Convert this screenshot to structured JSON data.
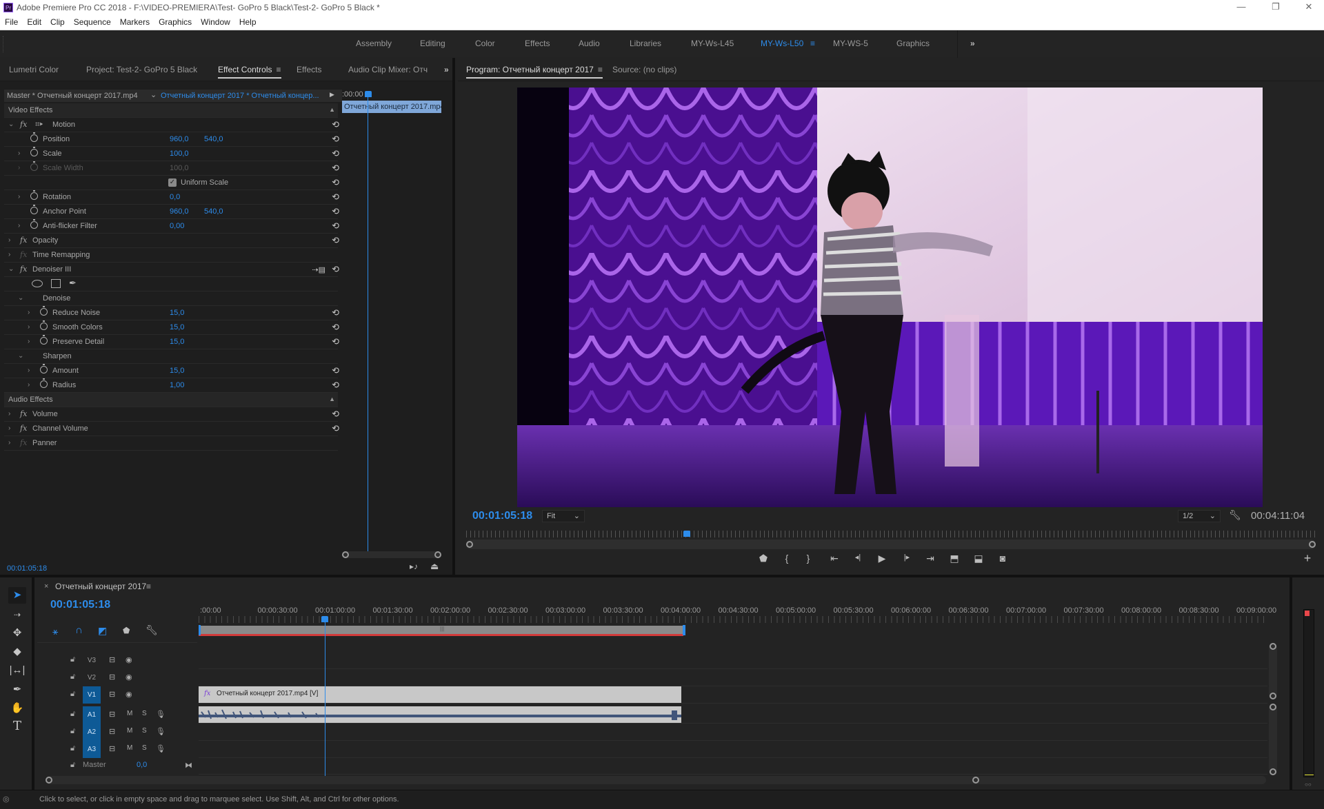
{
  "window": {
    "title": "Adobe Premiere Pro CC 2018 - F:\\VIDEO-PREMIERA\\Test- GoPro 5 Black\\Test-2- GoPro 5 Black *",
    "app_icon": "Pr",
    "controls": {
      "minimize": "—",
      "maximize": "❐",
      "close": "✕"
    }
  },
  "menu": [
    "File",
    "Edit",
    "Clip",
    "Sequence",
    "Markers",
    "Graphics",
    "Window",
    "Help"
  ],
  "workspaces": {
    "items": [
      "Assembly",
      "Editing",
      "Color",
      "Effects",
      "Audio",
      "Libraries",
      "MY-Ws-L45",
      "MY-Ws-L50",
      "MY-WS-5",
      "Graphics"
    ],
    "active": "MY-Ws-L50",
    "overflow": "»",
    "menu_icon": "≡"
  },
  "left_panel": {
    "tabs": [
      "Lumetri Color",
      "Project: Test-2- GoPro 5 Black",
      "Effect Controls",
      "Effects",
      "Audio Clip Mixer: Отчет"
    ],
    "active_tab": "Effect Controls",
    "overflow": "»",
    "header": {
      "master": "Master * Отчетный концерт 2017.mp4",
      "clip": "Отчетный концерт 2017 * Отчетный концер...",
      "timecode": ":00:00"
    },
    "mini_clip": "Отчетный концерт 2017.mp4",
    "sections": {
      "video": "Video Effects",
      "audio": "Audio Effects"
    },
    "rows": [
      {
        "label": "Motion",
        "type": "fx"
      },
      {
        "label": "Position",
        "v1": "960,0",
        "v2": "540,0"
      },
      {
        "label": "Scale",
        "v1": "100,0"
      },
      {
        "label": "Scale Width",
        "v1": "100,0"
      },
      {
        "label": "Uniform Scale",
        "checked": true
      },
      {
        "label": "Rotation",
        "v1": "0,0"
      },
      {
        "label": "Anchor Point",
        "v1": "960,0",
        "v2": "540,0"
      },
      {
        "label": "Anti-flicker Filter",
        "v1": "0,00"
      },
      {
        "label": "Opacity",
        "type": "fx"
      },
      {
        "label": "Time Remapping",
        "type": "fx"
      },
      {
        "label": "Denoiser III",
        "type": "fx"
      },
      {
        "label": "Denoise"
      },
      {
        "label": "Reduce Noise",
        "v1": "15,0"
      },
      {
        "label": "Smooth Colors",
        "v1": "15,0"
      },
      {
        "label": "Preserve Detail",
        "v1": "15,0"
      },
      {
        "label": "Sharpen"
      },
      {
        "label": "Amount",
        "v1": "15,0"
      },
      {
        "label": "Radius",
        "v1": "1,00"
      },
      {
        "label": "Volume",
        "type": "fx"
      },
      {
        "label": "Channel Volume",
        "type": "fx"
      },
      {
        "label": "Panner",
        "type": "fx"
      }
    ],
    "footer_timecode": "00:01:05:18"
  },
  "program_monitor": {
    "tabs": [
      "Program: Отчетный концерт 2017",
      "Source: (no clips)"
    ],
    "active_tab": "Program: Отчетный концерт 2017",
    "current_timecode": "00:01:05:18",
    "zoom": "Fit",
    "resolution": "1/2",
    "duration": "00:04:11:04",
    "playhead_fraction": 0.26,
    "transport": [
      "marker",
      "mark-in",
      "mark-out",
      "go-to-in",
      "step-back",
      "play",
      "step-forward",
      "go-to-out",
      "lift",
      "extract",
      "export-frame"
    ],
    "transport_glyphs": [
      "⬟",
      "{",
      "}",
      "⇤",
      "◂|",
      "▶",
      "|▸",
      "⇥",
      "⬒",
      "⬓",
      "◙"
    ],
    "add_button": "+"
  },
  "timeline": {
    "sequence_name": "Отчетный концерт 2017",
    "timecode": "00:01:05:18",
    "ruler": [
      ":00:00",
      "00:00:30:00",
      "00:01:00:00",
      "00:01:30:00",
      "00:02:00:00",
      "00:02:30:00",
      "00:03:00:00",
      "00:03:30:00",
      "00:04:00:00",
      "00:04:30:00",
      "00:05:00:00",
      "00:05:30:00",
      "00:06:00:00",
      "00:06:30:00",
      "00:07:00:00",
      "00:07:30:00",
      "00:08:00:00",
      "00:08:30:00",
      "00:09:00:00"
    ],
    "video_tracks": [
      {
        "id": "V3",
        "targeted": false
      },
      {
        "id": "V2",
        "targeted": false
      },
      {
        "id": "V1",
        "targeted": true
      }
    ],
    "audio_tracks": [
      {
        "id": "A1",
        "targeted": true
      },
      {
        "id": "A2",
        "targeted": true
      },
      {
        "id": "A3",
        "targeted": true
      }
    ],
    "mute": "M",
    "solo": "S",
    "master": {
      "label": "Master",
      "value": "0,0"
    },
    "video_clip": "Отчетный концерт 2017.mp4 [V]",
    "tools": [
      "selection",
      "track-select-forward",
      "ripple-edit",
      "razor",
      "slip",
      "pen",
      "hand",
      "type"
    ]
  },
  "status_bar": {
    "hint": "Click to select, or click in empty space and drag to marquee select. Use Shift, Alt, and Ctrl for other options."
  },
  "colors": {
    "accent": "#2d8ceb",
    "panel_bg": "#232323",
    "clip": "#c8c8c8",
    "work_area": "#d23a3a",
    "track_target": "#0e5a96"
  }
}
